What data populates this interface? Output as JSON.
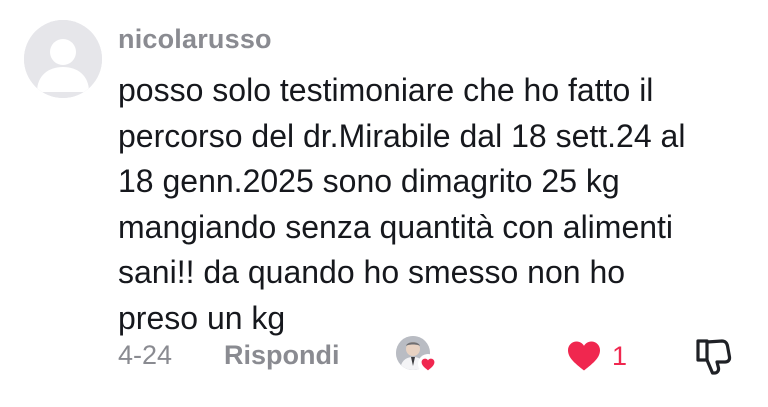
{
  "comment": {
    "username": "nicolarusso",
    "text_lines": [
      "posso solo testimoniare che ho fatto il",
      "percorso del dr.Mirabile dal 18 sett.24 al",
      "18 genn.2025 sono dimagrito 25 kg",
      "mangiando senza quantità con alimenti",
      "sani!! da quando ho smesso non ho",
      "preso un kg"
    ],
    "date": "4-24",
    "reply_label": "Rispondi",
    "like_count": "1",
    "liked": true
  },
  "icons": {
    "avatar": "default-avatar-icon",
    "creator_like": "creator-liked-avatar-icon",
    "like": "heart-filled-icon",
    "dislike": "thumbs-down-outline-icon"
  },
  "colors": {
    "username": "#8a8b91",
    "text": "#16181d",
    "meta": "#8a8b91",
    "like": "#f0274f",
    "avatar_bg": "#e6e6ea"
  }
}
